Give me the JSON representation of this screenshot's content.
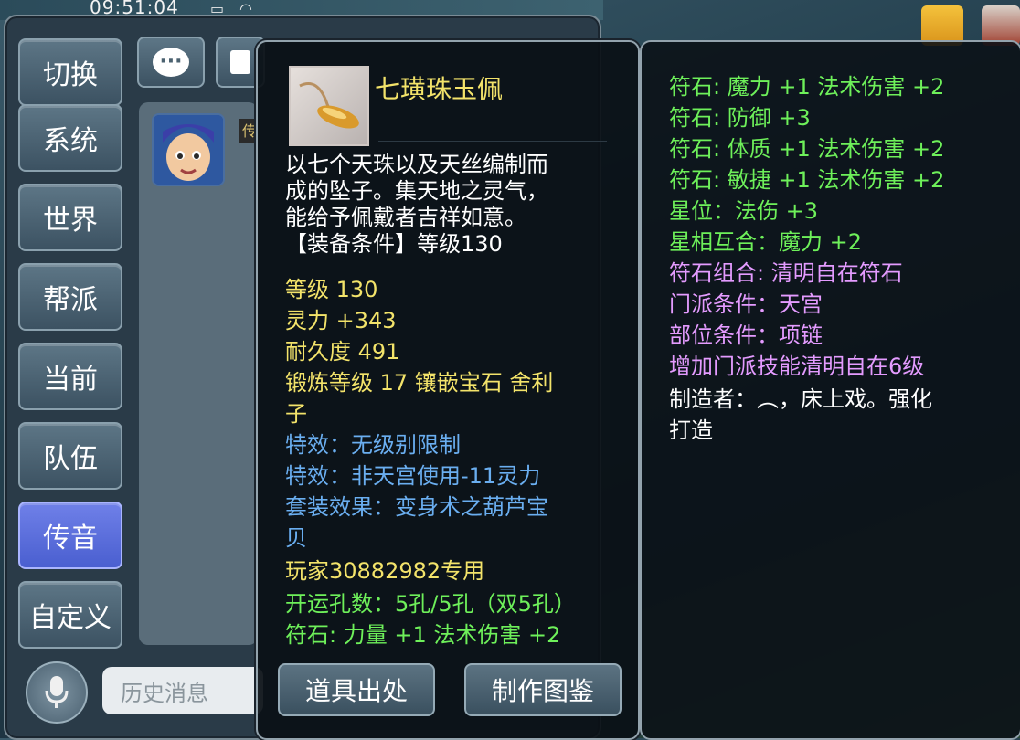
{
  "status": {
    "time": "09:51:04"
  },
  "channels": [
    {
      "label": "切换",
      "active": false
    },
    {
      "label": "系统",
      "active": false
    },
    {
      "label": "世界",
      "active": false
    },
    {
      "label": "帮派",
      "active": false
    },
    {
      "label": "当前",
      "active": false
    },
    {
      "label": "队伍",
      "active": false
    },
    {
      "label": "传音",
      "active": true
    },
    {
      "label": "自定义",
      "active": false
    }
  ],
  "chat": {
    "avatar_tag": "传",
    "history_placeholder": "历史消息"
  },
  "item": {
    "name": "七璜珠玉佩",
    "description_lines": [
      "以七个天珠以及天丝编制而",
      "成的坠子。集天地之灵气，",
      "能给予佩戴者吉祥如意。",
      "【装备条件】等级130"
    ],
    "stats": [
      {
        "text": "等级 130",
        "color": "yellow"
      },
      {
        "text": "灵力 +343",
        "color": "yellow"
      },
      {
        "text": "耐久度 491",
        "color": "yellow"
      },
      {
        "text": "锻炼等级 17  镶嵌宝石 舍利",
        "color": "yellow"
      },
      {
        "text": "子",
        "color": "yellow"
      },
      {
        "text": "特效：无级别限制",
        "color": "blue"
      },
      {
        "text": "特效：非天宫使用-11灵力",
        "color": "blue"
      },
      {
        "text": "套装效果：变身术之葫芦宝",
        "color": "blue"
      },
      {
        "text": "贝",
        "color": "blue"
      },
      {
        "text": "玩家30882982专用",
        "color": "yellow"
      },
      {
        "text": "开运孔数：5孔/5孔（双5孔）",
        "color": "green"
      },
      {
        "text": "符石: 力量 +1 法术伤害 +2",
        "color": "green"
      }
    ],
    "buttons": {
      "source": "道具出处",
      "catalog": "制作图鉴"
    }
  },
  "extra_stats": [
    {
      "text": "符石: 魔力 +1 法术伤害 +2",
      "color": "green"
    },
    {
      "text": "符石: 防御 +3",
      "color": "green"
    },
    {
      "text": "符石: 体质 +1 法术伤害 +2",
      "color": "green"
    },
    {
      "text": "符石: 敏捷 +1 法术伤害 +2",
      "color": "green"
    },
    {
      "text": "星位：法伤 +3",
      "color": "green"
    },
    {
      "text": "星相互合：魔力 +2",
      "color": "green"
    },
    {
      "text": "符石组合: 清明自在符石",
      "color": "pink"
    },
    {
      "text": "门派条件：天宫",
      "color": "pink"
    },
    {
      "text": "部位条件：项链",
      "color": "pink"
    },
    {
      "text": "增加门派技能清明自在6级",
      "color": "pink"
    },
    {
      "text": "制造者：︵，床上戏。强化",
      "color": "white"
    },
    {
      "text": "打造",
      "color": "white"
    }
  ]
}
